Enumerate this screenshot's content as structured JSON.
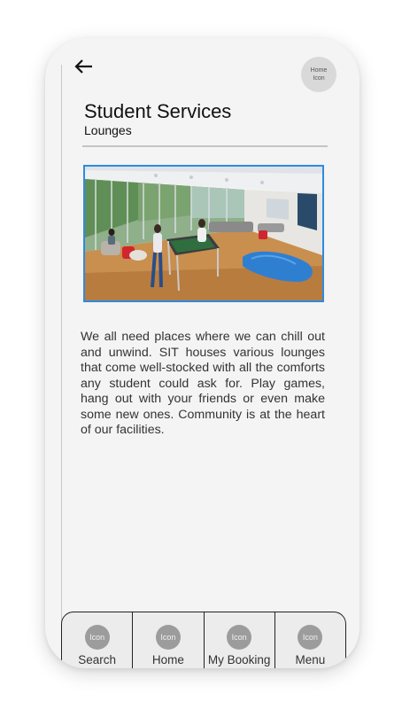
{
  "header": {
    "back_icon": "arrow-left-icon",
    "home_button_label": "Home Icon"
  },
  "page": {
    "title": "Student Services",
    "subtitle": "Lounges"
  },
  "hero_image": {
    "subject": "lounge-photo"
  },
  "content": {
    "body": "We all need places where we can chill out and unwind. SIT houses various lounges that come well-stocked with all the comforts any student could ask for. Play games, hang out with your friends or even make some new ones. Community is at the heart of our facilities."
  },
  "tabbar": {
    "items": [
      {
        "icon_label": "Icon",
        "label": "Search"
      },
      {
        "icon_label": "Icon",
        "label": "Home"
      },
      {
        "icon_label": "Icon",
        "label": "My Booking"
      },
      {
        "icon_label": "Icon",
        "label": "Menu"
      }
    ]
  },
  "colors": {
    "image_border": "#2e8be0",
    "screen_background": "#f4f4f4"
  }
}
